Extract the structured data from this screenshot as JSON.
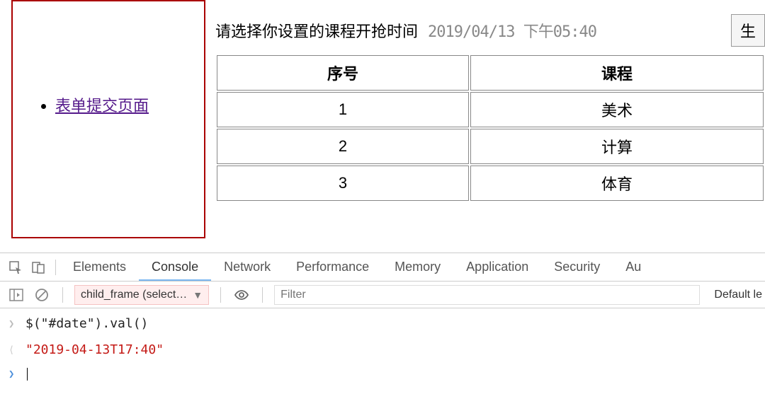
{
  "sidebar": {
    "link_label": "表单提交页面"
  },
  "form": {
    "prompt": "请选择你设置的课程开抢时间",
    "date_value": "2019/04/13 下午05:40",
    "button_label": "生"
  },
  "table": {
    "headers": {
      "seq": "序号",
      "course": "课程"
    },
    "rows": [
      {
        "seq": "1",
        "name": "美术"
      },
      {
        "seq": "2",
        "name": "计算"
      },
      {
        "seq": "3",
        "name": "体育"
      }
    ]
  },
  "devtools": {
    "tabs": {
      "elements": "Elements",
      "console": "Console",
      "network": "Network",
      "performance": "Performance",
      "memory": "Memory",
      "application": "Application",
      "security": "Security",
      "audits": "Au"
    },
    "context": "child_frame (select…",
    "filter_placeholder": "Filter",
    "level": "Default le",
    "lines": {
      "input": "$(\"#date\").val()",
      "output": "\"2019-04-13T17:40\""
    }
  }
}
